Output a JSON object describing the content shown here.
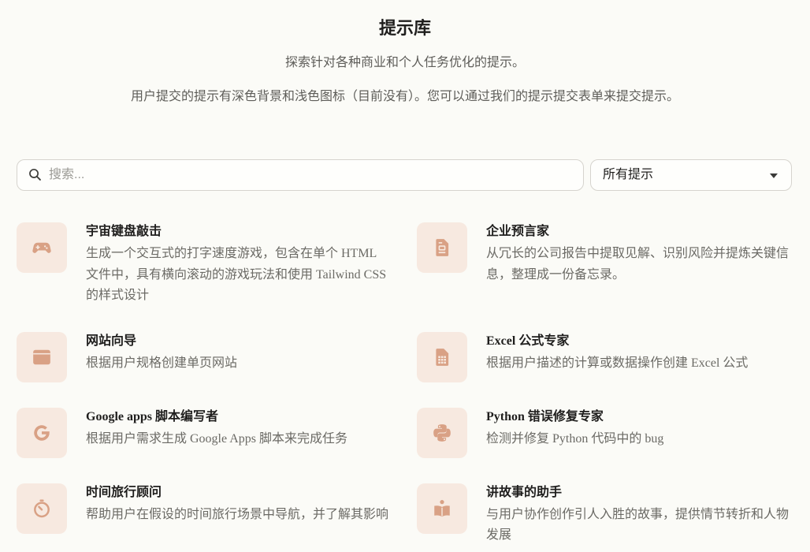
{
  "header": {
    "title": "提示库",
    "subtitle": "探索针对各种商业和个人任务优化的提示。",
    "note": "用户提交的提示有深色背景和浅色图标（目前没有）。您可以通过我们的提示提交表单来提交提示。"
  },
  "search": {
    "placeholder": "搜索...",
    "value": "",
    "icon": "search-icon"
  },
  "filter": {
    "selected": "所有提示",
    "icon": "caret-down-icon"
  },
  "prompts": [
    {
      "title": "宇宙键盘敲击",
      "description": "生成一个交互式的打字速度游戏，包含在单个 HTML 文件中，具有横向滚动的游戏玩法和使用 Tailwind CSS 的样式设计",
      "icon": "gamepad-icon"
    },
    {
      "title": "企业预言家",
      "description": "从冗长的公司报告中提取见解、识别风险并提炼关键信息，整理成一份备忘录。",
      "icon": "document-icon"
    },
    {
      "title": "网站向导",
      "description": "根据用户规格创建单页网站",
      "icon": "browser-window-icon"
    },
    {
      "title": "Excel 公式专家",
      "description": "根据用户描述的计算或数据操作创建 Excel 公式",
      "icon": "spreadsheet-file-icon"
    },
    {
      "title": "Google apps 脚本编写者",
      "description": "根据用户需求生成 Google Apps 脚本来完成任务",
      "icon": "google-g-icon"
    },
    {
      "title": "Python 错误修复专家",
      "description": "检测并修复 Python 代码中的 bug",
      "icon": "python-icon"
    },
    {
      "title": "时间旅行顾问",
      "description": "帮助用户在假设的时间旅行场景中导航，并了解其影响",
      "icon": "timer-icon"
    },
    {
      "title": "讲故事的助手",
      "description": "与用户协作创作引人入胜的故事，提供情节转折和人物发展",
      "icon": "book-reader-icon"
    }
  ],
  "colors": {
    "background": "#fbfbf7",
    "text": "#1f1e1d",
    "muted_text": "#6b6a65",
    "border": "#d6d4ce",
    "icon_tile": "#f7e9e0",
    "icon": "#d9a185"
  }
}
